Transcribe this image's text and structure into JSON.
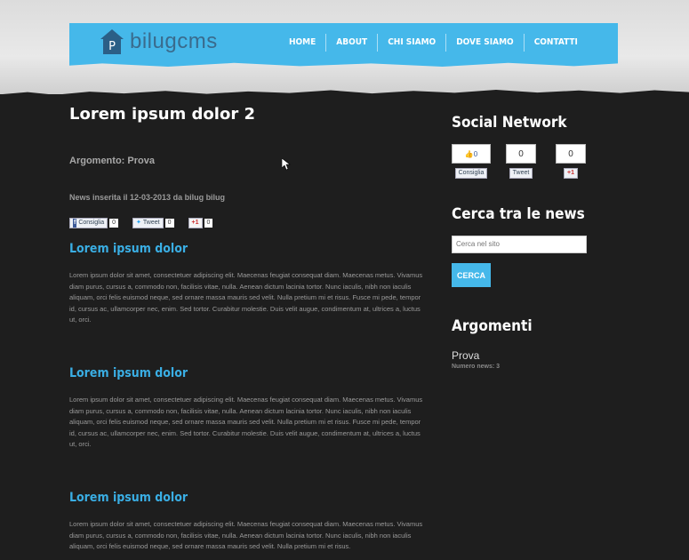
{
  "header": {
    "logo_text": "bilugcms",
    "logo_letter": "P",
    "nav": [
      "HOME",
      "ABOUT",
      "CHI SIAMO",
      "DOVE SIAMO",
      "CONTATTI"
    ]
  },
  "post": {
    "title": "Lorem ipsum dolor 2",
    "topic": "Argomento: Prova",
    "date_line": "News inserita il 12-03-2013 da bilug bilug",
    "share": {
      "facebook_label": "Consiglia",
      "facebook_count": "0",
      "twitter_label": "Tweet",
      "twitter_count": "0",
      "gplus_label": "+1",
      "gplus_count": "0"
    }
  },
  "articles": [
    {
      "title": "Lorem ipsum dolor",
      "body": "Lorem ipsum dolor sit amet, consectetuer adipiscing elit. Maecenas feugiat consequat diam. Maecenas metus. Vivamus diam purus, cursus a, commodo non, facilisis vitae, nulla. Aenean dictum lacinia tortor. Nunc iaculis, nibh non iaculis aliquam, orci felis euismod neque, sed ornare massa mauris sed velit. Nulla pretium mi et risus. Fusce mi pede, tempor id, cursus ac, ullamcorper nec, enim. Sed tortor. Curabitur molestie. Duis velit augue, condimentum at, ultrices a, luctus ut, orci."
    },
    {
      "title": "Lorem ipsum dolor",
      "body": "Lorem ipsum dolor sit amet, consectetuer adipiscing elit. Maecenas feugiat consequat diam. Maecenas metus. Vivamus diam purus, cursus a, commodo non, facilisis vitae, nulla. Aenean dictum lacinia tortor. Nunc iaculis, nibh non iaculis aliquam, orci felis euismod neque, sed ornare massa mauris sed velit. Nulla pretium mi et risus. Fusce mi pede, tempor id, cursus ac, ullamcorper nec, enim. Sed tortor. Curabitur molestie. Duis velit augue, condimentum at, ultrices a, luctus ut, orci."
    },
    {
      "title": "Lorem ipsum dolor",
      "body": "Lorem ipsum dolor sit amet, consectetuer adipiscing elit. Maecenas feugiat consequat diam. Maecenas metus. Vivamus diam purus, cursus a, commodo non, facilisis vitae, nulla. Aenean dictum lacinia tortor. Nunc iaculis, nibh non iaculis aliquam, orci felis euismod neque, sed ornare massa mauris sed velit. Nulla pretium mi et risus."
    }
  ],
  "sidebar": {
    "social_title": "Social Network",
    "social": {
      "fb_count": "0",
      "fb_label": "Consiglia",
      "tw_count": "0",
      "tw_label": "Tweet",
      "gp_count": "0",
      "gp_label": "+1"
    },
    "search_title": "Cerca tra le news",
    "search_placeholder": "Cerca nel sito",
    "search_button": "CERCA",
    "topics_title": "Argomenti",
    "topic_name": "Prova",
    "topic_count": "Numero news: 3"
  },
  "colors": {
    "accent": "#45b8ea",
    "background": "#1e1e1e",
    "link": "#3aaee4"
  }
}
